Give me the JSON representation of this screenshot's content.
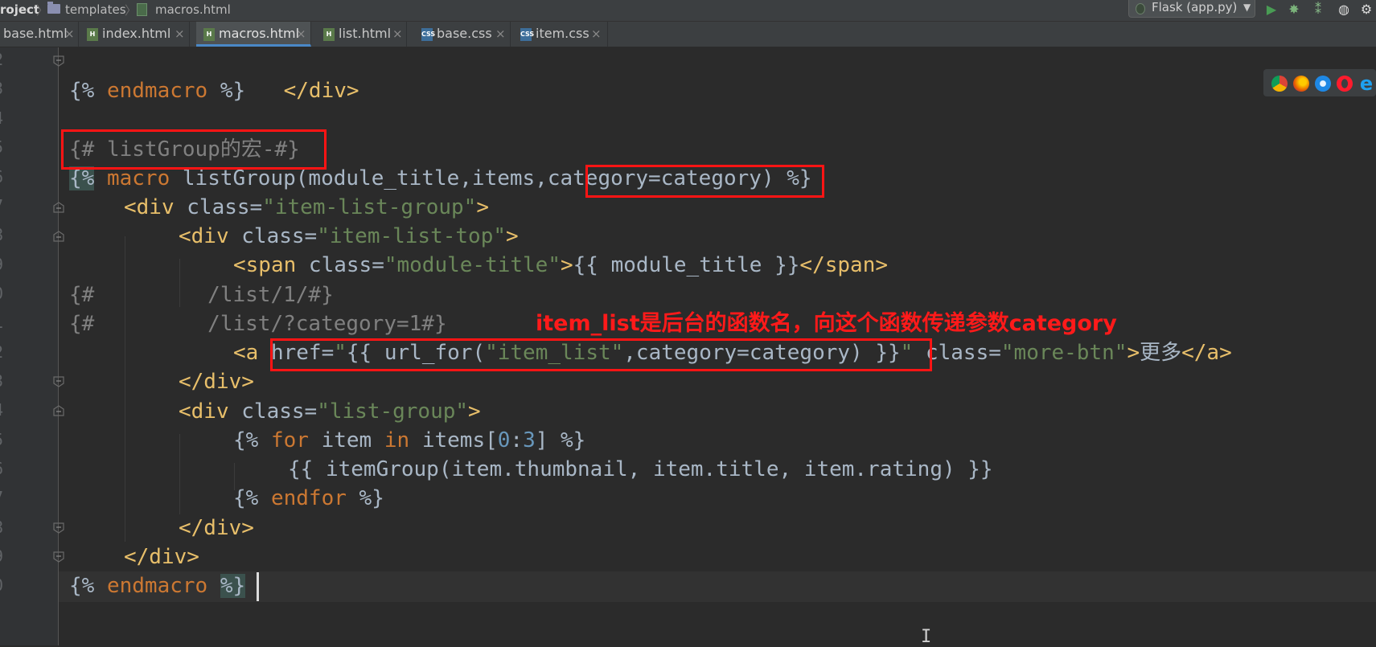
{
  "breadcrumb": {
    "project": "roject",
    "folder": "templates",
    "file": "macros.html"
  },
  "run_config": {
    "label": "Flask (app.py)"
  },
  "toolbar_icons": [
    "run-icon",
    "debug-icon",
    "coverage-icon",
    "profile-icon"
  ],
  "tabs": [
    {
      "label": "base.html",
      "type": "html",
      "active": false
    },
    {
      "label": "index.html",
      "type": "html",
      "active": false
    },
    {
      "label": "macros.html",
      "type": "html",
      "active": true
    },
    {
      "label": "list.html",
      "type": "html",
      "active": false
    },
    {
      "label": "base.css",
      "type": "css",
      "active": false
    },
    {
      "label": "item.css",
      "type": "css",
      "active": false
    }
  ],
  "line_numbers": [
    "2",
    "3",
    "4",
    "5",
    "6",
    "7",
    "8",
    "9",
    "0",
    "1",
    "2",
    "3",
    "4",
    "5",
    "6",
    "7",
    "8",
    "9",
    "0"
  ],
  "code": {
    "l1": "</div>",
    "l2_a": "{% ",
    "l2_b": "endmacro",
    "l2_c": " %}",
    "l4": "{# listGroup的宏-#}",
    "l5_open": "{%",
    "l5_kw": " macro",
    "l5_rest": " listGroup(module_title,items,category=category) %}",
    "l6_open": "<div ",
    "l6_attr": "class=",
    "l6_val": "\"item-list-group\"",
    "l6_close": ">",
    "l7_open": "<div ",
    "l7_attr": "class=",
    "l7_val": "\"item-list-top\"",
    "l7_close": ">",
    "l8_open": "<span ",
    "l8_attr": "class=",
    "l8_val": "\"module-title\"",
    "l8_mid": ">",
    "l8_expr": "{{ module_title }}",
    "l8_end": "</span>",
    "l9": "{#         /list/1/#}",
    "l10": "{#         /list/?category=1#}",
    "l11_open": "<a ",
    "l11_attr": "href=",
    "l11_q": "\"",
    "l11_expr1": "{{ url_for(",
    "l11_str": "\"item_list\"",
    "l11_expr2": ",category=category) }}",
    "l11_q2": "\" ",
    "l11_attr2": "class=",
    "l11_val2": "\"more-btn\"",
    "l11_gt": ">",
    "l11_text": "更多",
    "l11_end": "</a>",
    "l12": "</div>",
    "l13_open": "<div ",
    "l13_attr": "class=",
    "l13_val": "\"list-group\"",
    "l13_close": ">",
    "l14_a": "{% ",
    "l14_for": "for",
    "l14_b": " item ",
    "l14_in": "in",
    "l14_c": " items[",
    "l14_n0": "0",
    "l14_colon": ":",
    "l14_n3": "3",
    "l14_d": "] %}",
    "l15": "{{ itemGroup(item.thumbnail, item.title, item.rating) }}",
    "l16_a": "{% ",
    "l16_kw": "endfor",
    "l16_b": " %}",
    "l17": "</div>",
    "l18": "</div>",
    "l19_a": "{% ",
    "l19_kw": "endmacro",
    "l19_b": " ",
    "l19_c": "%}"
  },
  "annotation": "item_list是后台的函数名，向这个函数传递参数category",
  "browser_icons": [
    "chrome-icon",
    "firefox-icon",
    "safari-icon",
    "opera-icon",
    "ie-icon"
  ],
  "colors": {
    "editor_bg": "#2b2b2b",
    "tag": "#e8bf6a",
    "string": "#6a8759",
    "keyword": "#cc7832",
    "number": "#6897bb",
    "comment": "#808080",
    "annotation": "#ff1a1a",
    "active_tab_underline": "#4a88c7"
  }
}
